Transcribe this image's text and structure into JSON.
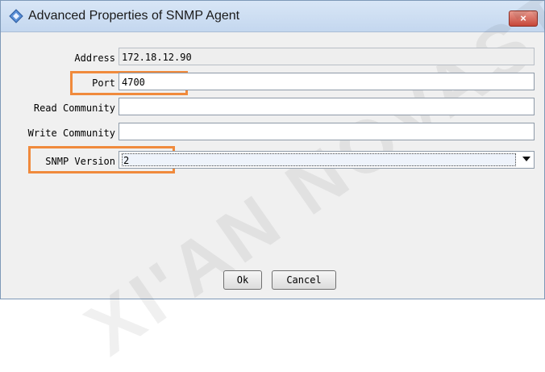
{
  "window": {
    "title": "Advanced Properties of SNMP Agent",
    "close_label": "×"
  },
  "form": {
    "address_label": "Address",
    "address_value": "172.18.12.90",
    "port_label": "Port",
    "port_value": "4700",
    "read_community_label": "Read Community",
    "read_community_value": "",
    "write_community_label": "Write Community",
    "write_community_value": "",
    "snmp_version_label": "SNMP Version",
    "snmp_version_value": "2"
  },
  "buttons": {
    "ok": "Ok",
    "cancel": "Cancel"
  },
  "watermark": {
    "text": "XI'AN NOVASTAR"
  },
  "colors": {
    "highlight": "#f08a3c",
    "titlebar": "#c4d7ef"
  }
}
